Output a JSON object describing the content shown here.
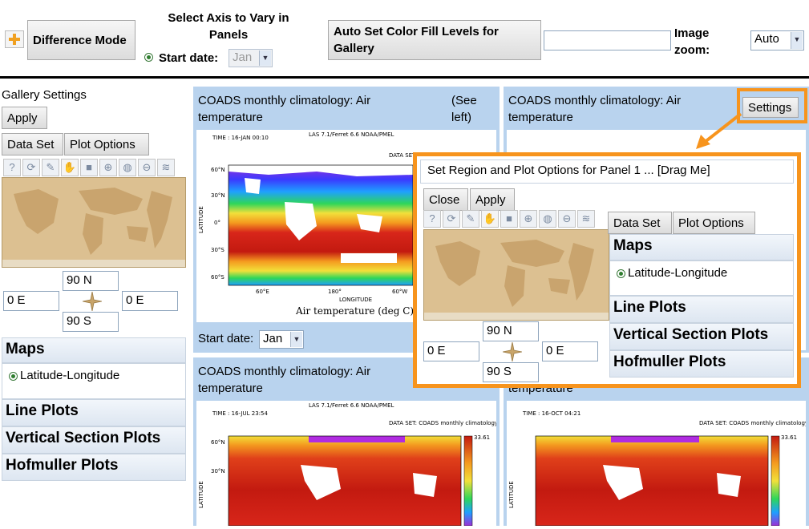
{
  "toolbar": {
    "plus_icon": "plus-icon",
    "difference_mode": "Difference Mode",
    "select_axis": "Select Axis to Vary in Panels",
    "start_date_label": "Start date:",
    "start_date_value": "Jan",
    "auto_set_fill": "Auto Set Color Fill Levels for Gallery",
    "fill_levels_value": "",
    "image_zoom_label": "Image zoom:",
    "image_zoom_value": "Auto"
  },
  "gallery_settings": {
    "title": "Gallery Settings",
    "apply": "Apply",
    "tabs": [
      "Data Set",
      "Plot Options"
    ],
    "north": "90 N",
    "south": "90 S",
    "west": "0 E",
    "east": "0 E",
    "maps_header": "Maps",
    "lat_lon": "Latitude-Longitude",
    "line_plots": "Line Plots",
    "vertical_section": "Vertical Section Plots",
    "hofmuller": "Hofmuller Plots"
  },
  "panels": {
    "p1_title": "COADS monthly climatology: Air temperature",
    "p1_see_left": "(See left)",
    "p1_start_label": "Start date:",
    "p1_start_value": "Jan",
    "p2_title": "COADS monthly climatology: Air temperature",
    "p2_settings": "Settings",
    "p3_title": "COADS monthly climatology: Air temperature",
    "p4_title": "temperature",
    "plot_xlabel": "Air temperature (deg C)"
  },
  "popup": {
    "title": "Set Region and Plot Options for Panel 1 ... [Drag Me]",
    "close": "Close",
    "apply": "Apply",
    "tabs": [
      "Data Set",
      "Plot Options"
    ],
    "north": "90 N",
    "south": "90 S",
    "west": "0 E",
    "east": "0 E",
    "maps_header": "Maps",
    "lat_lon": "Latitude-Longitude",
    "line_plots": "Line Plots",
    "vertical_section": "Vertical Section Plots",
    "hofmuller": "Hofmuller Plots"
  },
  "colors": {
    "highlight": "#f7941d",
    "panel_header": "#b9d3ee"
  }
}
